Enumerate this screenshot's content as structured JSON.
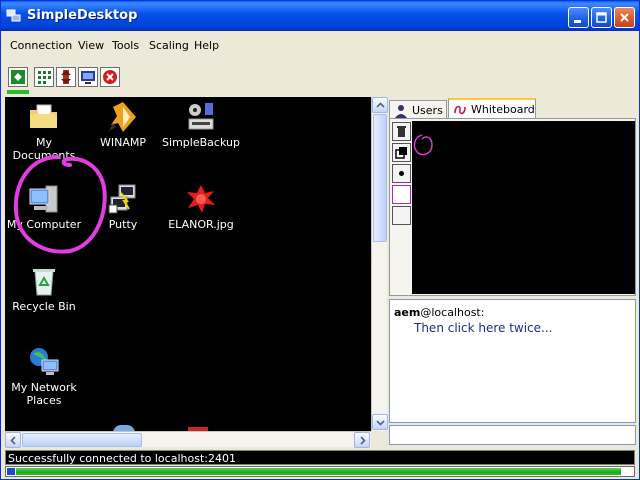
{
  "window": {
    "title": "SimpleDesktop"
  },
  "menu": [
    "Connection",
    "View",
    "Tools",
    "Scaling",
    "Help"
  ],
  "toolbar": {
    "tools": [
      "connect-icon",
      "grid-icon",
      "scroll-icon",
      "monitor-icon",
      "stop-icon"
    ]
  },
  "desktop": {
    "icons": [
      {
        "label": "My Documents",
        "icon": "folder-icon"
      },
      {
        "label": "WINAMP",
        "icon": "winamp-icon"
      },
      {
        "label": "SimpleBackup",
        "icon": "backup-icon"
      },
      {
        "label": "My Computer",
        "icon": "computer-icon"
      },
      {
        "label": "Putty",
        "icon": "putty-icon"
      },
      {
        "label": "ELANOR.jpg",
        "icon": "image-file-icon"
      },
      {
        "label": "Recycle Bin",
        "icon": "recycle-bin-icon"
      },
      {
        "label": "My Network Places",
        "icon": "network-icon"
      }
    ]
  },
  "tabs": {
    "users": "Users",
    "whiteboard": "Whiteboard",
    "active": "Whiteboard"
  },
  "chat": {
    "user": "aem",
    "host": "@localhost:",
    "message": "Then click here twice..."
  },
  "status": {
    "text": "Successfully connected to localhost:2401"
  },
  "progress": {
    "percent": 98
  },
  "colors": {
    "annotation": "#e23de0",
    "title_bar": "#0a52e8",
    "progress": "#2cbd28"
  }
}
